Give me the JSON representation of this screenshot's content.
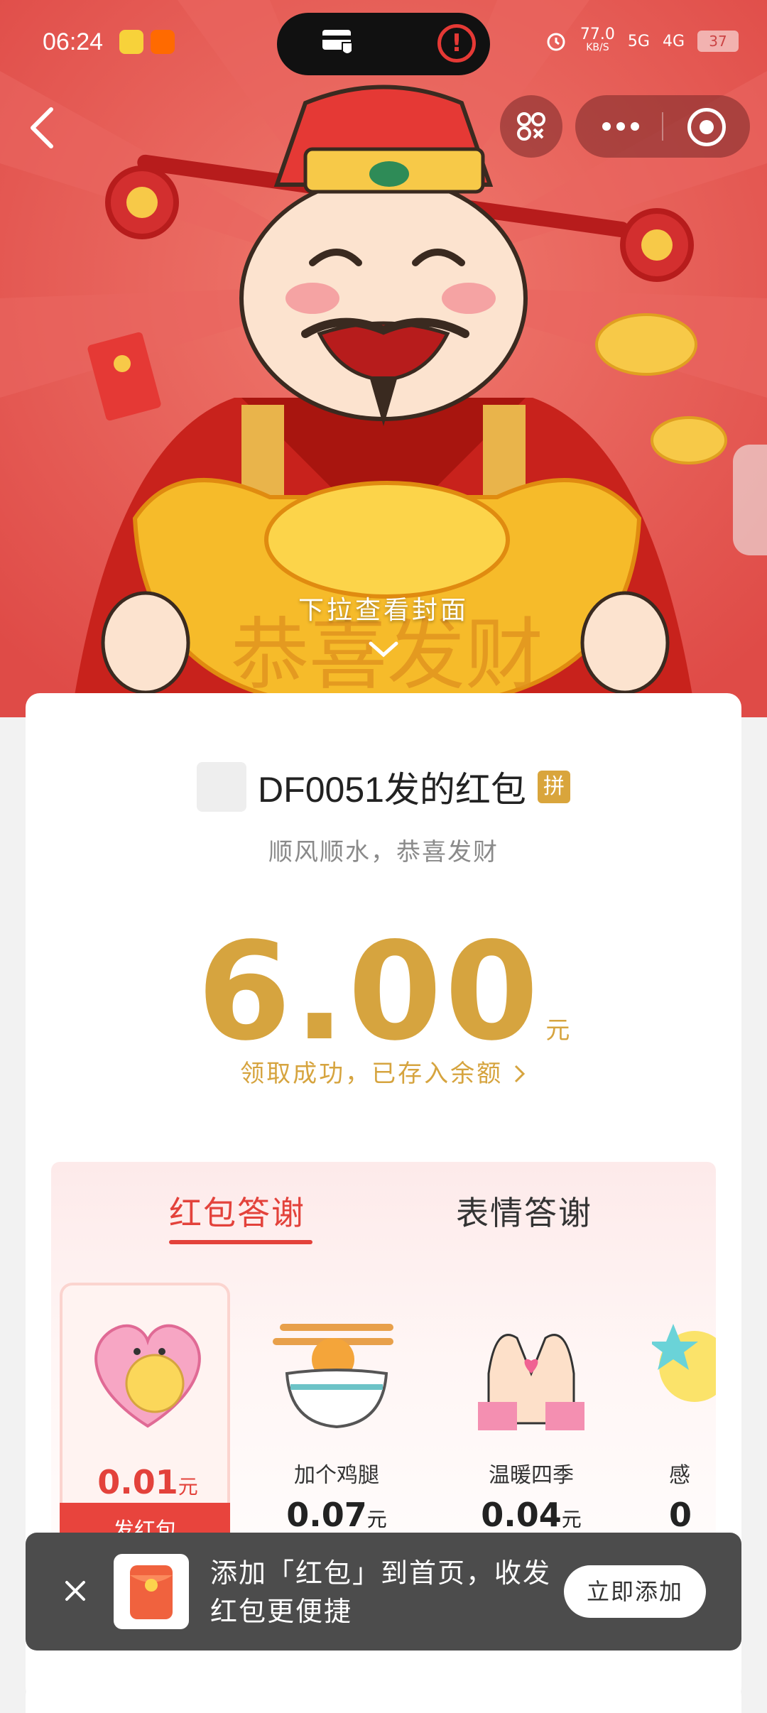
{
  "status": {
    "time": "06:24",
    "network_speed": "77.0",
    "network_unit": "KB/S",
    "signal_1": "5G",
    "signal_2": "4G",
    "battery": "37"
  },
  "hero": {
    "pull_hint": "下拉查看封面"
  },
  "card": {
    "sender_name": "DF0051发的红包",
    "badge": "拼",
    "blessing": "顺风顺水，恭喜发财",
    "amount": "6.00",
    "unit": "元",
    "saved_text": "领取成功，已存入余额"
  },
  "thanks": {
    "tabs": [
      "红包答谢",
      "表情答谢"
    ],
    "gifts": [
      {
        "name": "",
        "price": "0.01",
        "unit": "元",
        "action": "发红包"
      },
      {
        "name": "加个鸡腿",
        "price": "0.07",
        "unit": "元"
      },
      {
        "name": "温暖四季",
        "price": "0.04",
        "unit": "元"
      },
      {
        "name": "感",
        "price": "0",
        "unit": ""
      }
    ]
  },
  "toast": {
    "text": "添加「红包」到首页，收发红包更便捷",
    "button": "立即添加"
  },
  "colors": {
    "accent_red": "#e3423b",
    "gold": "#d6a43f",
    "hero_bg": "#e75a55"
  }
}
